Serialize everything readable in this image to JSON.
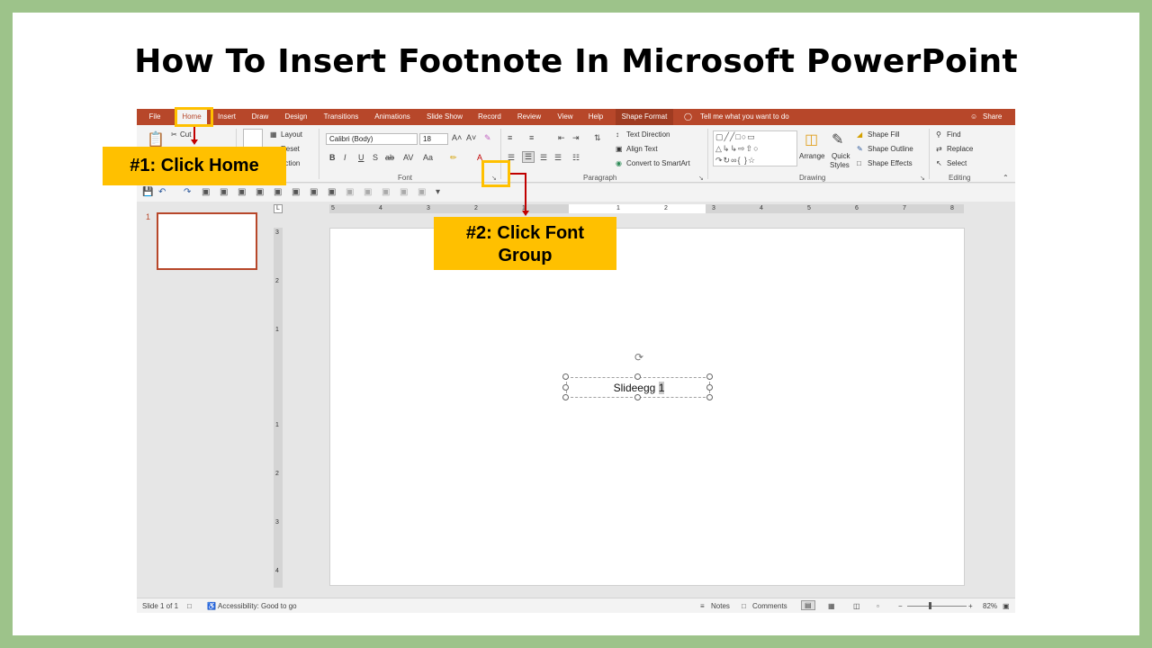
{
  "title": "How To Insert Footnote In Microsoft PowerPoint",
  "tabs": [
    "File",
    "Home",
    "Insert",
    "Draw",
    "Design",
    "Transitions",
    "Animations",
    "Slide Show",
    "Record",
    "Review",
    "View",
    "Help",
    "Shape Format"
  ],
  "tell_me": "Tell me what you want to do",
  "share": "Share",
  "ribbon": {
    "clipboard": {
      "cut": "Cut"
    },
    "slides": {
      "layout": "Layout",
      "reset": "Reset",
      "section": "ection"
    },
    "font": {
      "group_label": "Font",
      "font_name": "Calibri (Body)",
      "font_size": "18",
      "bold": "B",
      "italic": "I",
      "underline": "U",
      "shadow": "S",
      "strike": "ab",
      "case": "Aa"
    },
    "paragraph": {
      "group_label": "Paragraph",
      "text_direction": "Text Direction",
      "align_text": "Align Text",
      "convert_smartart": "Convert to SmartArt"
    },
    "drawing": {
      "group_label": "Drawing",
      "arrange": "Arrange",
      "quick_styles_1": "Quick",
      "quick_styles_2": "Styles",
      "shape_fill": "Shape Fill",
      "shape_outline": "Shape Outline",
      "shape_effects": "Shape Effects"
    },
    "editing": {
      "group_label": "Editing",
      "find": "Find",
      "replace": "Replace",
      "select": "Select"
    }
  },
  "ruler_h": [
    "5",
    "4",
    "3",
    "2",
    "1",
    "1",
    "2",
    "3",
    "4",
    "5",
    "6",
    "7",
    "8"
  ],
  "ruler_v": [
    "3",
    "2",
    "1",
    "1",
    "2",
    "3",
    "4"
  ],
  "thumbnail_number": "1",
  "slide_text": "Slideegg",
  "slide_text_footnote": "1",
  "status": {
    "slide": "Slide 1 of 1",
    "accessibility": "Accessibility: Good to go",
    "notes": "Notes",
    "comments": "Comments",
    "zoom": "82%"
  },
  "callouts": {
    "step1": "#1: Click Home",
    "step2_line1": "#2: Click Font",
    "step2_line2": "Group"
  },
  "colors": {
    "accent": "#b7472a",
    "callout": "#ffc000",
    "arrow": "#c00000",
    "border": "#9dc38a"
  }
}
